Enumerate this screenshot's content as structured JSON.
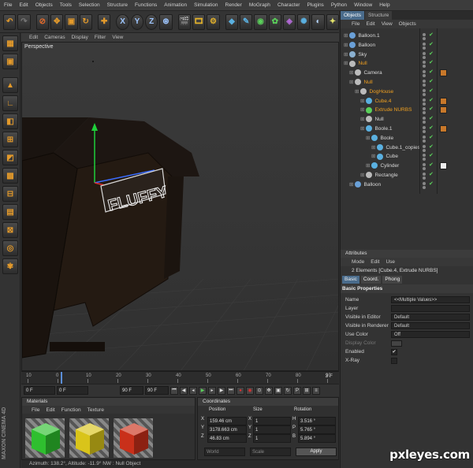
{
  "menubar": [
    "File",
    "Edit",
    "Objects",
    "Tools",
    "Selection",
    "Structure",
    "Functions",
    "Animation",
    "Simulation",
    "Render",
    "MoGraph",
    "Character",
    "Plugins",
    "Python",
    "Window",
    "Help"
  ],
  "toolbar_axes": [
    "X",
    "Y",
    "Z"
  ],
  "viewport_menu": [
    "Edit",
    "Cameras",
    "Display",
    "Filter",
    "View"
  ],
  "viewport_label": "Perspective",
  "sign_text": "FLUFFY",
  "timeline": {
    "ticks": [
      "10",
      "0",
      "10",
      "20",
      "30",
      "40",
      "50",
      "60",
      "70",
      "80",
      "90"
    ],
    "current_frame": "3 F"
  },
  "transport": {
    "start": "0 F",
    "start2": "0 F",
    "end": "90 F",
    "end2": "90 F"
  },
  "materials": {
    "title": "Materials",
    "menu": [
      "File",
      "Edit",
      "Function",
      "Texture"
    ],
    "colors": [
      "#2fbf2f",
      "#d9c41a",
      "#c9301a"
    ]
  },
  "coordinates": {
    "title": "Coordinates",
    "headers": [
      "Position",
      "Size",
      "Rotation"
    ],
    "rows": [
      {
        "axis": "X",
        "pos": "159.46 cm",
        "size": "1",
        "rl": "H",
        "rot": "3.516 °"
      },
      {
        "axis": "Y",
        "pos": "3178.663 cm",
        "size": "1",
        "rl": "P",
        "rot": "5.765 °"
      },
      {
        "axis": "Z",
        "pos": "46.83 cm",
        "size": "1",
        "rl": "B",
        "rot": "5.894 °"
      }
    ],
    "mode1": "World",
    "mode2": "Scale",
    "apply": "Apply"
  },
  "status": "Azimuth: 138.2°, Altitude: -11.9°  NW  : Null Object",
  "objects": {
    "tabs": [
      "Objects",
      "Structure"
    ],
    "menu": [
      "File",
      "Edit",
      "View",
      "Objects"
    ],
    "items": [
      {
        "label": "Balloon.1",
        "indent": 0,
        "color": "#6aa0d8",
        "sel": false
      },
      {
        "label": "Balloon",
        "indent": 0,
        "color": "#6aa0d8",
        "sel": false
      },
      {
        "label": "Sky",
        "indent": 0,
        "color": "#8ab0d0",
        "sel": false
      },
      {
        "label": "Null",
        "indent": 0,
        "color": "#bbbbbb",
        "sel": true
      },
      {
        "label": "Camera",
        "indent": 1,
        "color": "#bbbbbb",
        "sel": false
      },
      {
        "label": "Null",
        "indent": 1,
        "color": "#bbbbbb",
        "sel": true
      },
      {
        "label": "DogHouse",
        "indent": 2,
        "color": "#bbbbbb",
        "sel": true
      },
      {
        "label": "Cube.4",
        "indent": 3,
        "color": "#5ab0e0",
        "sel": true
      },
      {
        "label": "Extrude NURBS",
        "indent": 3,
        "color": "#5ad05a",
        "sel": true
      },
      {
        "label": "Null",
        "indent": 3,
        "color": "#bbbbbb",
        "sel": false
      },
      {
        "label": "Boole.1",
        "indent": 3,
        "color": "#5ab0e0",
        "sel": false
      },
      {
        "label": "Boole",
        "indent": 4,
        "color": "#5ab0e0",
        "sel": false
      },
      {
        "label": "Cube.1_copies",
        "indent": 5,
        "color": "#5ab0e0",
        "sel": false
      },
      {
        "label": "Cube",
        "indent": 5,
        "color": "#5ab0e0",
        "sel": false
      },
      {
        "label": "Cylinder",
        "indent": 4,
        "color": "#5ab0e0",
        "sel": false
      },
      {
        "label": "Rectangle",
        "indent": 3,
        "color": "#bbbbbb",
        "sel": false
      },
      {
        "label": "Balloon",
        "indent": 1,
        "color": "#6aa0d8",
        "sel": false
      }
    ]
  },
  "attributes": {
    "title": "Attributes",
    "menu": [
      "Mode",
      "Edit",
      "Use"
    ],
    "elements": "2 Elements [Cube.4, Extrude NURBS]",
    "tabs": [
      "Basic",
      "Coord.",
      "Phong"
    ],
    "section": "Basic Properties",
    "rows": [
      {
        "label": "Name",
        "value": "<<Multiple Values>>"
      },
      {
        "label": "Layer",
        "value": ""
      },
      {
        "label": "Visible in Editor",
        "value": "Default"
      },
      {
        "label": "Visible in Renderer",
        "value": "Default"
      },
      {
        "label": "Use Color",
        "value": "Off"
      },
      {
        "label": "Display Color",
        "value": ""
      },
      {
        "label": "Enabled",
        "value": "✔"
      },
      {
        "label": "X-Ray",
        "value": ""
      }
    ]
  },
  "watermark": "pxleyes.com",
  "brand": "MAXON CINEMA 4D"
}
